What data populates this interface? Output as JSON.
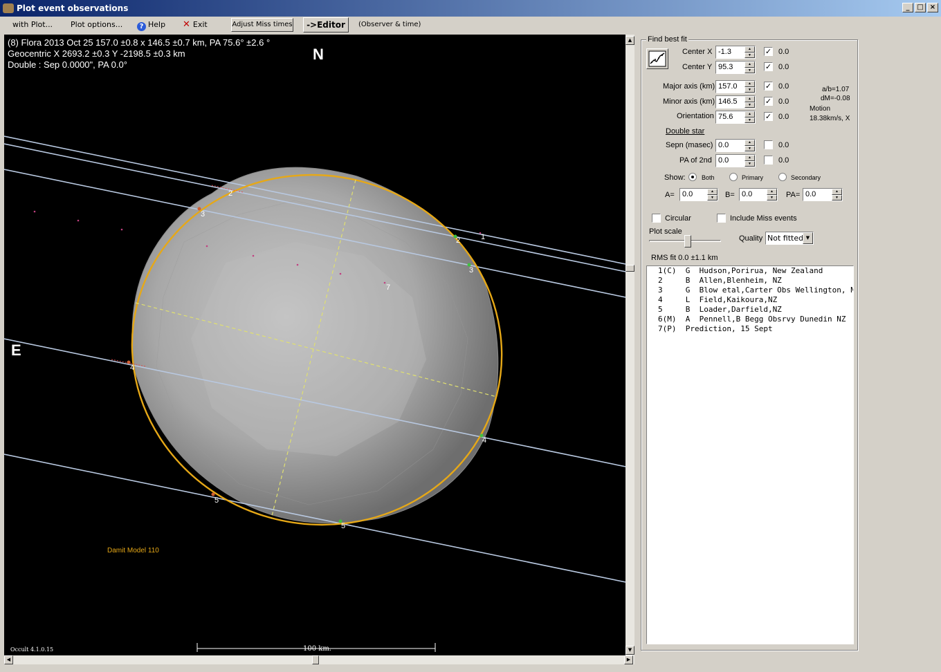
{
  "window": {
    "title": "Plot event observations"
  },
  "menu": {
    "with_plot": "with Plot...",
    "plot_options": "Plot options...",
    "help": "Help",
    "exit": "Exit",
    "adjust_miss_times": "Adjust Miss times",
    "editor": "->Editor",
    "observer_time": "(Observer & time)"
  },
  "plot": {
    "line1": "(8) Flora  2013 Oct 25   157.0 ±0.8 x 146.5 ±0.7 km, PA 75.6° ±2.6 °",
    "line2": "Geocentric X 2693.2 ±0.3  Y -2198.5 ±0.3 km",
    "line3": "Double : Sep  0.0000\", PA 0.0°",
    "north": "N",
    "east": "E",
    "model_label": "Damit Model 110",
    "version": "Occult 4.1.0.15",
    "scale_label": "100 km.",
    "chord_labels": [
      "1",
      "2",
      "3",
      "2",
      "3",
      "4",
      "4",
      "5",
      "5",
      "7"
    ]
  },
  "panel": {
    "group_title": "Find best fit",
    "center_x": {
      "label": "Center X",
      "value": "-1.3",
      "checked": true,
      "result": "0.0"
    },
    "center_y": {
      "label": "Center Y",
      "value": "95.3",
      "checked": true,
      "result": "0.0"
    },
    "major_axis": {
      "label": "Major axis (km)",
      "value": "157.0",
      "checked": true,
      "result": "0.0"
    },
    "minor_axis": {
      "label": "Minor axis (km)",
      "value": "146.5",
      "checked": true,
      "result": "0.0"
    },
    "orientation": {
      "label": "Orientation",
      "value": "75.6",
      "checked": true,
      "result": "0.0"
    },
    "ratio_ab": "a/b=1.07",
    "dm": "dM=-0.08",
    "motion_label": "Motion",
    "motion_value": "18.38km/s, X",
    "double_star": "Double star",
    "sepn": {
      "label": "Sepn (masec)",
      "value": "0.0",
      "checked": false,
      "result": "0.0"
    },
    "pa2nd": {
      "label": "PA of 2nd",
      "value": "0.0",
      "checked": false,
      "result": "0.0"
    },
    "show_label": "Show:",
    "show_both": "Both",
    "show_primary": "Primary",
    "show_secondary": "Secondary",
    "a_label": "A=",
    "a_value": "0.0",
    "b_label": "B=",
    "b_value": "0.0",
    "pa_label": "PA=",
    "pa_value": "0.0",
    "circular": "Circular",
    "include_miss": "Include Miss events",
    "plot_scale": "Plot scale",
    "quality_label": "Quality",
    "quality_value": "Not fitted",
    "rms_fit": "RMS fit 0.0 ±1.1 km",
    "observers": [
      "1(C)  G  Hudson,Porirua, New Zealand",
      "2     B  Allen,Blenheim, NZ",
      "3     G  Blow etal,Carter Obs Wellington, N",
      "4     L  Field,Kaikoura,NZ",
      "5     B  Loader,Darfield,NZ",
      "6(M)  A  Pennell,B Begg Obsrvy Dunedin NZ",
      "7(P)  Prediction, 15 Sept"
    ]
  }
}
